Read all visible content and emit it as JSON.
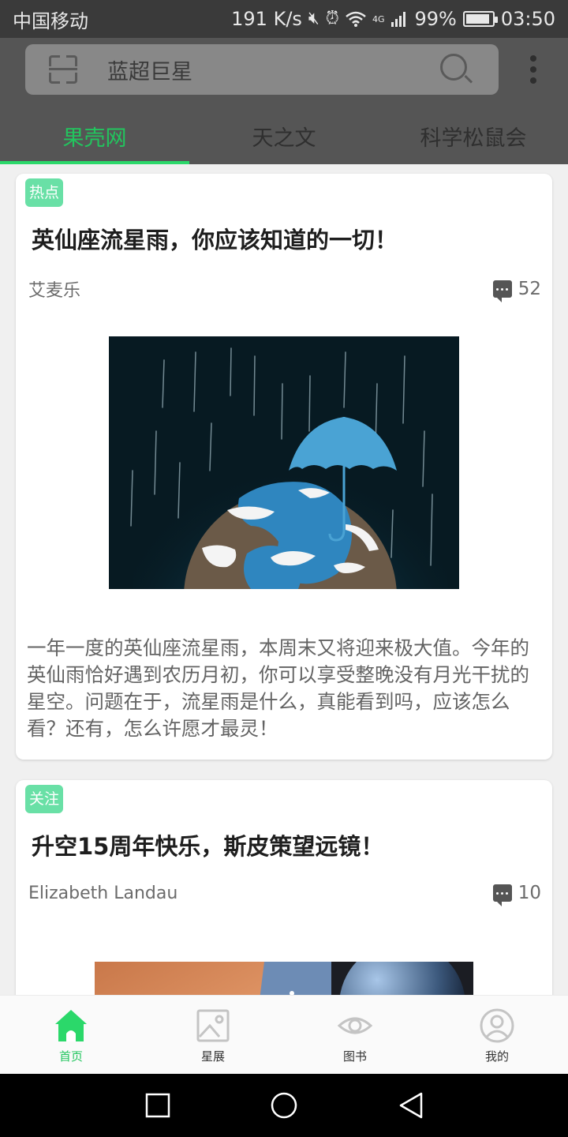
{
  "status_bar": {
    "carrier": "中国移动",
    "net_speed": "191 K/s",
    "network_type": "4G",
    "battery": "99%",
    "time": "03:50"
  },
  "search": {
    "query": "蓝超巨星"
  },
  "tabs": [
    {
      "label": "果壳网",
      "active": true
    },
    {
      "label": "天之文",
      "active": false
    },
    {
      "label": "科学松鼠会",
      "active": false
    }
  ],
  "articles": [
    {
      "tag": "热点",
      "title": "英仙座流星雨，你应该知道的一切！",
      "author": "艾麦乐",
      "comment_count": "52",
      "excerpt": "一年一度的英仙座流星雨，本周末又将迎来极大值。今年的英仙雨恰好遇到农历月初，你可以享受整晚没有月光干扰的星空。问题在于，流星雨是什么，真能看到吗，应该怎么看？还有，怎么许愿才最灵！"
    },
    {
      "tag": "关注",
      "title": "升空15周年快乐，斯皮策望远镜！",
      "author": "Elizabeth Landau",
      "comment_count": "10"
    }
  ],
  "bottom_nav": [
    {
      "label": "首页",
      "icon": "home-icon",
      "active": true
    },
    {
      "label": "星展",
      "icon": "image-icon",
      "active": false
    },
    {
      "label": "图书",
      "icon": "eye-icon",
      "active": false
    },
    {
      "label": "我的",
      "icon": "user-icon",
      "active": false
    }
  ],
  "colors": {
    "accent": "#22c55e",
    "tag_bg": "#69e0a6",
    "appbar_bg": "#555555"
  }
}
